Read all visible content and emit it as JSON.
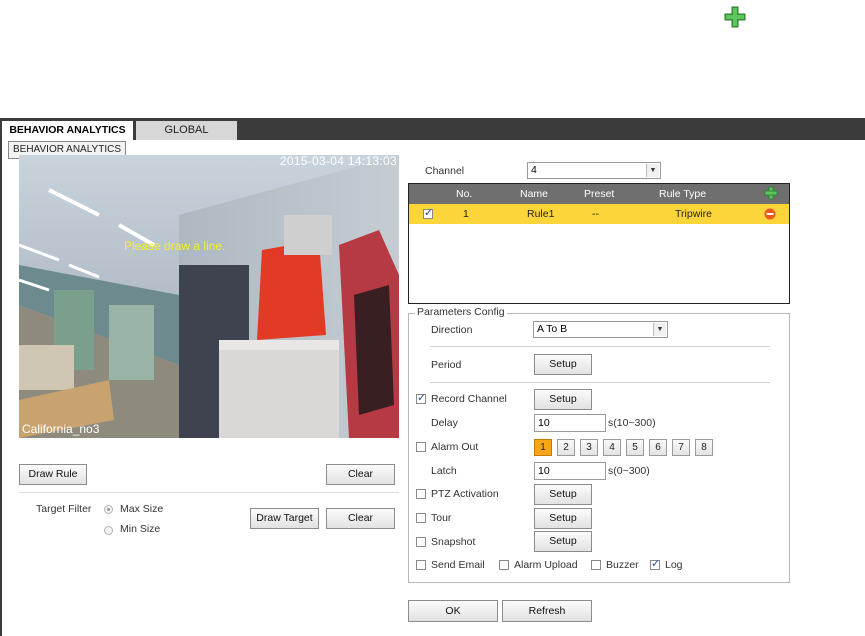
{
  "tabs": [
    {
      "label": "BEHAVIOR ANALYTICS"
    },
    {
      "label": "GLOBAL"
    }
  ],
  "tooltip": "BEHAVIOR ANALYTICS",
  "video": {
    "timestamp": "2015-03-04 14:13:03",
    "hint": "Please draw a line.",
    "camera_name": "California_no3"
  },
  "buttons": {
    "draw_rule": "Draw Rule",
    "clear_rule": "Clear",
    "draw_target": "Draw Target",
    "clear_target": "Clear",
    "ok": "OK",
    "refresh": "Refresh"
  },
  "target_filter": {
    "label": "Target Filter",
    "options": [
      "Max Size",
      "Min Size"
    ],
    "selected": "Max Size"
  },
  "channel": {
    "label": "Channel",
    "value": "4"
  },
  "rule_table": {
    "headers": [
      "No.",
      "Name",
      "Preset",
      "Rule Type"
    ],
    "rows": [
      {
        "checked": true,
        "no": "1",
        "name": "Rule1",
        "preset": "--",
        "type": "Tripwire"
      }
    ]
  },
  "params": {
    "legend": "Parameters Config",
    "direction": {
      "label": "Direction",
      "value": "A To B"
    },
    "period": {
      "label": "Period",
      "button": "Setup"
    },
    "record_channel": {
      "label": "Record Channel",
      "checked": true,
      "button": "Setup"
    },
    "delay": {
      "label": "Delay",
      "value": "10",
      "range": "s(10~300)"
    },
    "alarm_out": {
      "label": "Alarm Out",
      "checked": false,
      "outputs": [
        "1",
        "2",
        "3",
        "4",
        "5",
        "6",
        "7",
        "8"
      ],
      "active": [
        "1"
      ]
    },
    "latch": {
      "label": "Latch",
      "value": "10",
      "range": "s(0~300)"
    },
    "ptz": {
      "label": "PTZ Activation",
      "checked": false,
      "button": "Setup"
    },
    "tour": {
      "label": "Tour",
      "checked": false,
      "button": "Setup"
    },
    "snapshot": {
      "label": "Snapshot",
      "checked": false,
      "button": "Setup"
    },
    "send_email": {
      "label": "Send Email",
      "checked": false
    },
    "alarm_upload": {
      "label": "Alarm Upload",
      "checked": false
    },
    "buzzer": {
      "label": "Buzzer",
      "checked": false
    },
    "log": {
      "label": "Log",
      "checked": true
    }
  },
  "colors": {
    "tab_bar": "#3b3b3b",
    "table_header": "#6f6f6f",
    "selected_row": "#fcd53a",
    "active_alarm": "#f7a417",
    "add_icon": "#3aa33a",
    "delete_icon": "#e85a1c"
  }
}
